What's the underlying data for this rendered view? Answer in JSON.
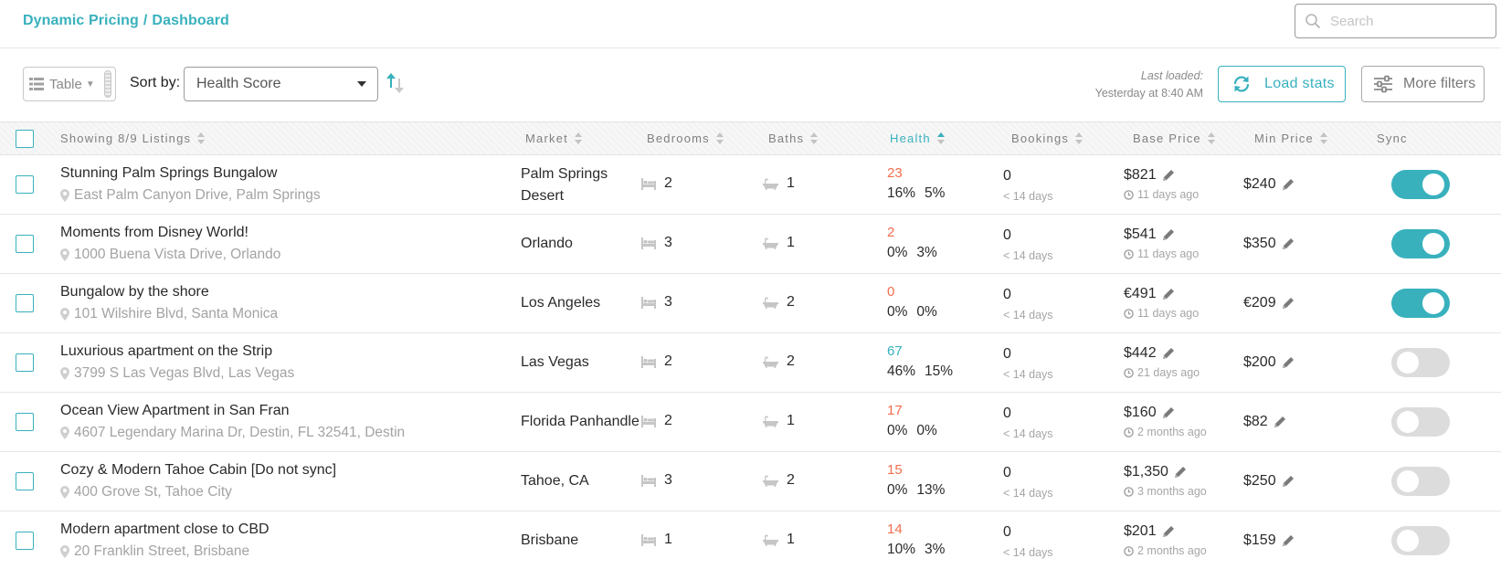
{
  "header": {
    "breadcrumb": [
      "Dynamic Pricing",
      "Dashboard"
    ],
    "search_placeholder": "Search"
  },
  "toolbar": {
    "view_label": "Table",
    "sort_label": "Sort by:",
    "sort_value": "Health Score",
    "last_loaded_label": "Last loaded:",
    "last_loaded_value": "Yesterday at 8:40 AM",
    "load_stats_label": "Load stats",
    "more_filters_label": "More filters"
  },
  "columns": {
    "listings": "Showing 8/9 Listings",
    "market": "Market",
    "bedrooms": "Bedrooms",
    "baths": "Baths",
    "health": "Health",
    "bookings": "Bookings",
    "base_price": "Base Price",
    "min_price": "Min Price",
    "sync": "Sync"
  },
  "colors": {
    "accent": "#38b1bd",
    "warning": "#f26d4e"
  },
  "listings": [
    {
      "title": "Stunning Palm Springs Bungalow",
      "address": "East Palm Canyon Drive, Palm Springs",
      "market": "Palm Springs Desert",
      "bedrooms": "2",
      "baths": "1",
      "health": "23",
      "health_color": "red",
      "pct1": "16%",
      "pct2": "5%",
      "bookings": "0",
      "bookings_sub": "< 14 days",
      "base_price": "$821",
      "updated": "11 days ago",
      "min_price": "$240",
      "sync": true
    },
    {
      "title": "Moments from Disney World!",
      "address": "1000 Buena Vista Drive, Orlando",
      "market": "Orlando",
      "bedrooms": "3",
      "baths": "1",
      "health": "2",
      "health_color": "red",
      "pct1": "0%",
      "pct2": "3%",
      "bookings": "0",
      "bookings_sub": "< 14 days",
      "base_price": "$541",
      "updated": "11 days ago",
      "min_price": "$350",
      "sync": true
    },
    {
      "title": "Bungalow by the shore",
      "address": "101 Wilshire Blvd, Santa Monica",
      "market": "Los Angeles",
      "bedrooms": "3",
      "baths": "2",
      "health": "0",
      "health_color": "red",
      "pct1": "0%",
      "pct2": "0%",
      "bookings": "0",
      "bookings_sub": "< 14 days",
      "base_price": "€491",
      "updated": "11 days ago",
      "min_price": "€209",
      "sync": true
    },
    {
      "title": "Luxurious apartment on the Strip",
      "address": "3799 S Las Vegas Blvd, Las Vegas",
      "market": "Las Vegas",
      "bedrooms": "2",
      "baths": "2",
      "health": "67",
      "health_color": "teal",
      "pct1": "46%",
      "pct2": "15%",
      "bookings": "0",
      "bookings_sub": "< 14 days",
      "base_price": "$442",
      "updated": "21 days ago",
      "min_price": "$200",
      "sync": false
    },
    {
      "title": "Ocean View Apartment in San Fran",
      "address": "4607 Legendary Marina Dr, Destin, FL 32541, Destin",
      "market": "Florida Panhandle",
      "bedrooms": "2",
      "baths": "1",
      "health": "17",
      "health_color": "red",
      "pct1": "0%",
      "pct2": "0%",
      "bookings": "0",
      "bookings_sub": "< 14 days",
      "base_price": "$160",
      "updated": "2 months ago",
      "min_price": "$82",
      "sync": false
    },
    {
      "title": "Cozy & Modern Tahoe Cabin [Do not sync]",
      "address": "400 Grove St, Tahoe City",
      "market": "Tahoe, CA",
      "bedrooms": "3",
      "baths": "2",
      "health": "15",
      "health_color": "red",
      "pct1": "0%",
      "pct2": "13%",
      "bookings": "0",
      "bookings_sub": "< 14 days",
      "base_price": "$1,350",
      "updated": "3 months ago",
      "min_price": "$250",
      "sync": false
    },
    {
      "title": "Modern apartment close to CBD",
      "address": "20 Franklin Street, Brisbane",
      "market": "Brisbane",
      "bedrooms": "1",
      "baths": "1",
      "health": "14",
      "health_color": "red",
      "pct1": "10%",
      "pct2": "3%",
      "bookings": "0",
      "bookings_sub": "< 14 days",
      "base_price": "$201",
      "updated": "2 months ago",
      "min_price": "$159",
      "sync": false
    }
  ]
}
